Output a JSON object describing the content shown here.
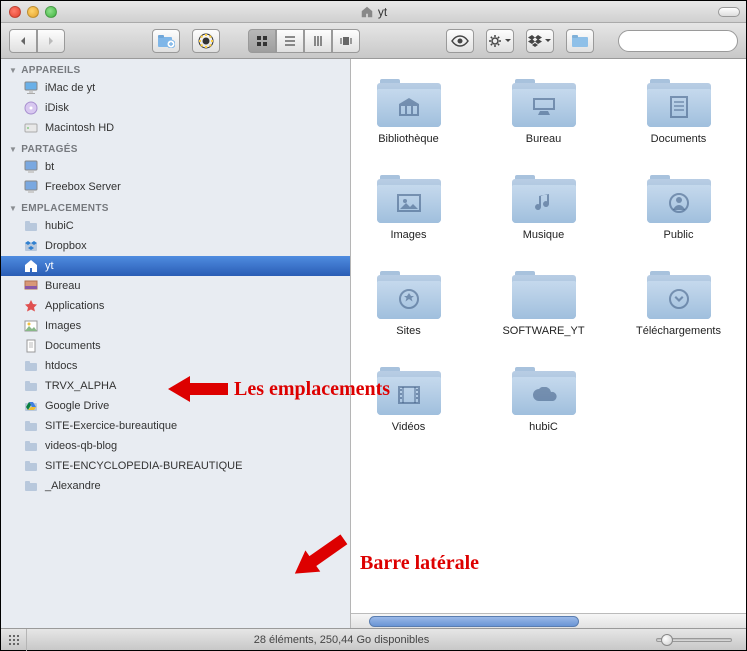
{
  "window": {
    "title": "yt"
  },
  "toolbar": {
    "search_placeholder": ""
  },
  "sidebar": {
    "sections": [
      {
        "header": "APPAREILS",
        "items": [
          {
            "label": "iMac de yt",
            "icon": "imac"
          },
          {
            "label": "iDisk",
            "icon": "idisk"
          },
          {
            "label": "Macintosh HD",
            "icon": "hdd"
          }
        ]
      },
      {
        "header": "PARTAGÉS",
        "items": [
          {
            "label": "bt",
            "icon": "netpc"
          },
          {
            "label": "Freebox Server",
            "icon": "netpc"
          }
        ]
      },
      {
        "header": "EMPLACEMENTS",
        "items": [
          {
            "label": "hubiC",
            "icon": "folder"
          },
          {
            "label": "Dropbox",
            "icon": "dropbox"
          },
          {
            "label": "yt",
            "icon": "home",
            "selected": true
          },
          {
            "label": "Bureau",
            "icon": "desktop"
          },
          {
            "label": "Applications",
            "icon": "apps"
          },
          {
            "label": "Images",
            "icon": "images"
          },
          {
            "label": "Documents",
            "icon": "docs"
          },
          {
            "label": "htdocs",
            "icon": "folder"
          },
          {
            "label": "TRVX_ALPHA",
            "icon": "folder"
          },
          {
            "label": "Google Drive",
            "icon": "gdrive"
          },
          {
            "label": "SITE-Exercice-bureautique",
            "icon": "folder"
          },
          {
            "label": "videos-qb-blog",
            "icon": "folder"
          },
          {
            "label": "SITE-ENCYCLOPEDIA-BUREAUTIQUE",
            "icon": "folder"
          },
          {
            "label": "_Alexandre",
            "icon": "folder"
          }
        ]
      }
    ]
  },
  "folders": [
    {
      "label": "Bibliothèque",
      "glyph": "library"
    },
    {
      "label": "Bureau",
      "glyph": "desktop"
    },
    {
      "label": "Documents",
      "glyph": "docs"
    },
    {
      "label": "Images",
      "glyph": "images"
    },
    {
      "label": "Musique",
      "glyph": "music"
    },
    {
      "label": "Public",
      "glyph": "public"
    },
    {
      "label": "Sites",
      "glyph": "sites"
    },
    {
      "label": "SOFTWARE_YT",
      "glyph": ""
    },
    {
      "label": "Téléchargements",
      "glyph": "download"
    },
    {
      "label": "Vidéos",
      "glyph": "video"
    },
    {
      "label": "hubiC",
      "glyph": "cloud"
    }
  ],
  "status": {
    "text": "28 éléments, 250,44 Go disponibles"
  },
  "annotations": {
    "a1": "Les emplacements",
    "a2": "Barre latérale"
  }
}
